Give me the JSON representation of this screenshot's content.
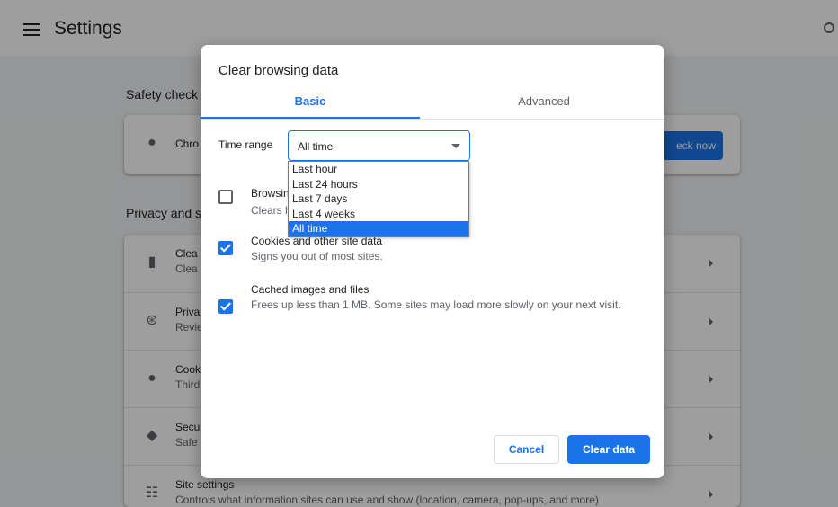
{
  "header": {
    "title": "Settings",
    "menu_icon": "hamburger-icon",
    "search_icon": "search-icon"
  },
  "safety_check": {
    "section_title": "Safety check",
    "row_title": "Chro",
    "button_label": "eck now"
  },
  "privacy": {
    "section_title": "Privacy and s",
    "rows": [
      {
        "icon": "trash-icon",
        "title": "Clea",
        "sub": "Clea"
      },
      {
        "icon": "privacy-sandbox-icon",
        "title": "Priva",
        "sub": "Revie"
      },
      {
        "icon": "cookie-icon",
        "title": "Cook",
        "sub": "Third"
      },
      {
        "icon": "shield-icon",
        "title": "Secu",
        "sub": "Safe"
      },
      {
        "icon": "sliders-icon",
        "title": "Site settings",
        "sub": "Controls what information sites can use and show (location, camera, pop-ups, and more)"
      }
    ]
  },
  "dialog": {
    "title": "Clear browsing data",
    "tabs": {
      "basic": "Basic",
      "advanced": "Advanced"
    },
    "time_range": {
      "label": "Time range",
      "value": "All time",
      "options": [
        "Last hour",
        "Last 24 hours",
        "Last 7 days",
        "Last 4 weeks",
        "All time"
      ],
      "selected": "All time"
    },
    "items": [
      {
        "title": "Browsing history",
        "sub": "Clears history from all synced devices",
        "checked": false
      },
      {
        "title": "Cookies and other site data",
        "sub": "Signs you out of most sites.",
        "checked": true
      },
      {
        "title": "Cached images and files",
        "sub": "Frees up less than 1 MB. Some sites may load more slowly on your next visit.",
        "checked": true
      }
    ],
    "cancel_label": "Cancel",
    "confirm_label": "Clear data"
  },
  "colors": {
    "accent": "#1a73e8",
    "scrim": "rgba(0,0,0,0.38)"
  }
}
